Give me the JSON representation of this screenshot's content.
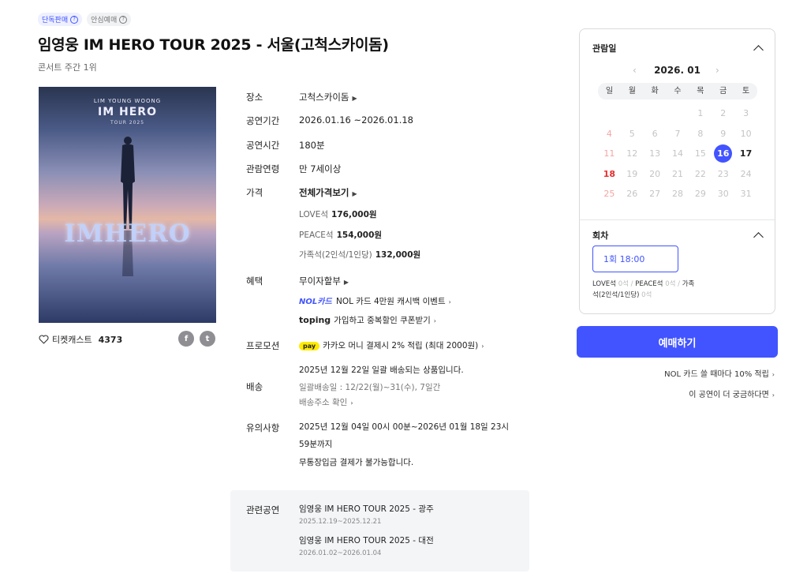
{
  "badges": {
    "exclusive": "단독판매",
    "safe": "안심예매",
    "question_icon": "?"
  },
  "title": "임영웅 IM HERO TOUR 2025 - 서울(고척스카이돔)",
  "rank": "콘서트 주간 1위",
  "poster": {
    "top_line": "LIM YOUNG WOONG",
    "heading": "IM HERO",
    "sub": "TOUR 2025",
    "overlay": "IMHERO"
  },
  "likes": {
    "label": "티켓캐스트",
    "count": "4373",
    "icon": "heart-outline-icon"
  },
  "share": {
    "facebook": "f",
    "twitter": "t"
  },
  "info": {
    "venue_label": "장소",
    "venue_value": "고척스카이돔",
    "period_label": "공연기간",
    "period_value": "2026.01.16 ~2026.01.18",
    "duration_label": "공연시간",
    "duration_value": "180분",
    "age_label": "관람연령",
    "age_value": "만 7세이상",
    "price_label": "가격",
    "price_value": "전체가격보기",
    "prices": [
      {
        "seat": "LOVE석",
        "price": "176,000원"
      },
      {
        "seat": "PEACE석",
        "price": "154,000원"
      },
      {
        "seat": "가족석(2인석/1인당)",
        "price": "132,000원"
      }
    ],
    "benefit_label": "혜택",
    "benefit_value": "무이자할부",
    "nol_logo": "NOL카드",
    "nol_text": "NOL 카드 4만원 캐시백 이벤트",
    "toping_logo": "toping",
    "toping_text": "가입하고 중복할인 쿠폰받기",
    "promo_label": "프로모션",
    "pay_logo": "pay",
    "promo_text": "카카오 머니 결제시 2% 적립 (최대 2000원)",
    "delivery_label": "배송",
    "delivery_line1": "2025년 12월 22일 일괄 배송되는 상품입니다.",
    "delivery_line2": "일괄배송일 : 12/22(월)~31(수), 7일간",
    "delivery_line3": "배송주소 확인",
    "notice_label": "유의사항",
    "notice_line1": "2025년 12월 04일 00시 00분~2026년 01월 18일 23시",
    "notice_line2": "59분까지",
    "notice_line3": "무통장입금 결제가 불가능합니다."
  },
  "related": {
    "label": "관련공연",
    "items": [
      {
        "title": "임영웅 IM HERO TOUR 2025 - 광주",
        "dates": "2025.12.19~2025.12.21"
      },
      {
        "title": "임영웅 IM HERO TOUR 2025 - 대전",
        "dates": "2026.01.02~2026.01.04"
      }
    ]
  },
  "sidebar": {
    "date_title": "관람일",
    "month": "2026. 01",
    "prev": "‹",
    "next": "›",
    "weekdays": [
      "일",
      "월",
      "화",
      "수",
      "목",
      "금",
      "토"
    ],
    "weeks": [
      [
        "",
        "",
        "",
        "",
        "1",
        "2",
        "3"
      ],
      [
        "4",
        "5",
        "6",
        "7",
        "8",
        "9",
        "10"
      ],
      [
        "11",
        "12",
        "13",
        "14",
        "15",
        "16",
        "17"
      ],
      [
        "18",
        "19",
        "20",
        "21",
        "22",
        "23",
        "24"
      ],
      [
        "25",
        "26",
        "27",
        "28",
        "29",
        "30",
        "31"
      ]
    ],
    "selected_day": "16",
    "available_days": [
      "16",
      "17",
      "18"
    ],
    "round_title": "회차",
    "round_button": "1회 18:00",
    "seat_love": "LOVE석",
    "seat_love_count": "0석",
    "seat_peace": "PEACE석",
    "seat_peace_count": "0석",
    "seat_family": "가족석(2인석/1인당)",
    "seat_family_count": "0석",
    "slash": "/"
  },
  "book_button": "예매하기",
  "promo_nol": "NOL 카드 쓸 때마다 10% 적립",
  "promo_curious": "이 공연이 더 궁금하다면",
  "colors": {
    "accent": "#4154ff",
    "sunday": "#e62e2e",
    "kakao": "#ffeb00"
  }
}
